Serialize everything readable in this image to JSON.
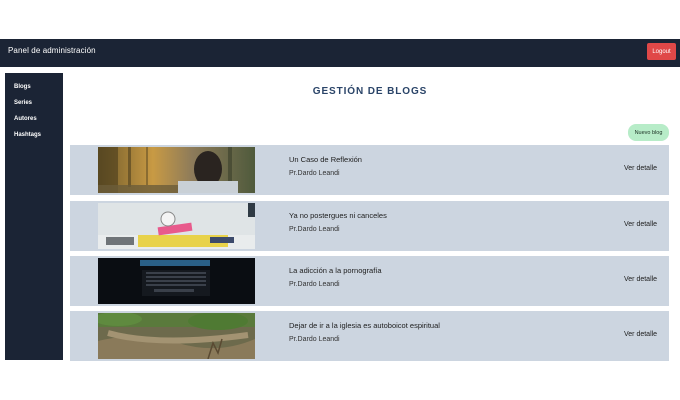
{
  "header": {
    "brand": "Panel de administración",
    "logout_label": "Logout"
  },
  "sidebar": {
    "items": [
      {
        "label": "Blogs"
      },
      {
        "label": "Series"
      },
      {
        "label": "Autores"
      },
      {
        "label": "Hashtags"
      }
    ]
  },
  "main": {
    "title": "GESTIÓN DE BLOGS",
    "new_blog_label": "Nuevo blog",
    "detail_label": "Ver detalle",
    "blogs": [
      {
        "title": "Un Caso de Reflexión",
        "author": "Pr.Dardo Leandi"
      },
      {
        "title": "Ya no postergues ni canceles",
        "author": "Pr.Dardo Leandi"
      },
      {
        "title": "La adicción a la pornografía",
        "author": "Pr.Dardo Leandi"
      },
      {
        "title": "Dejar de ir a la iglesia es autoboicot espiritual",
        "author": "Pr.Dardo Leandi"
      }
    ]
  },
  "colors": {
    "navbar": "#1b2435",
    "logout": "#e04848",
    "accent_title": "#2a4468",
    "new_blog": "#b7ecc8",
    "row_bg": "#ccd5e0"
  }
}
